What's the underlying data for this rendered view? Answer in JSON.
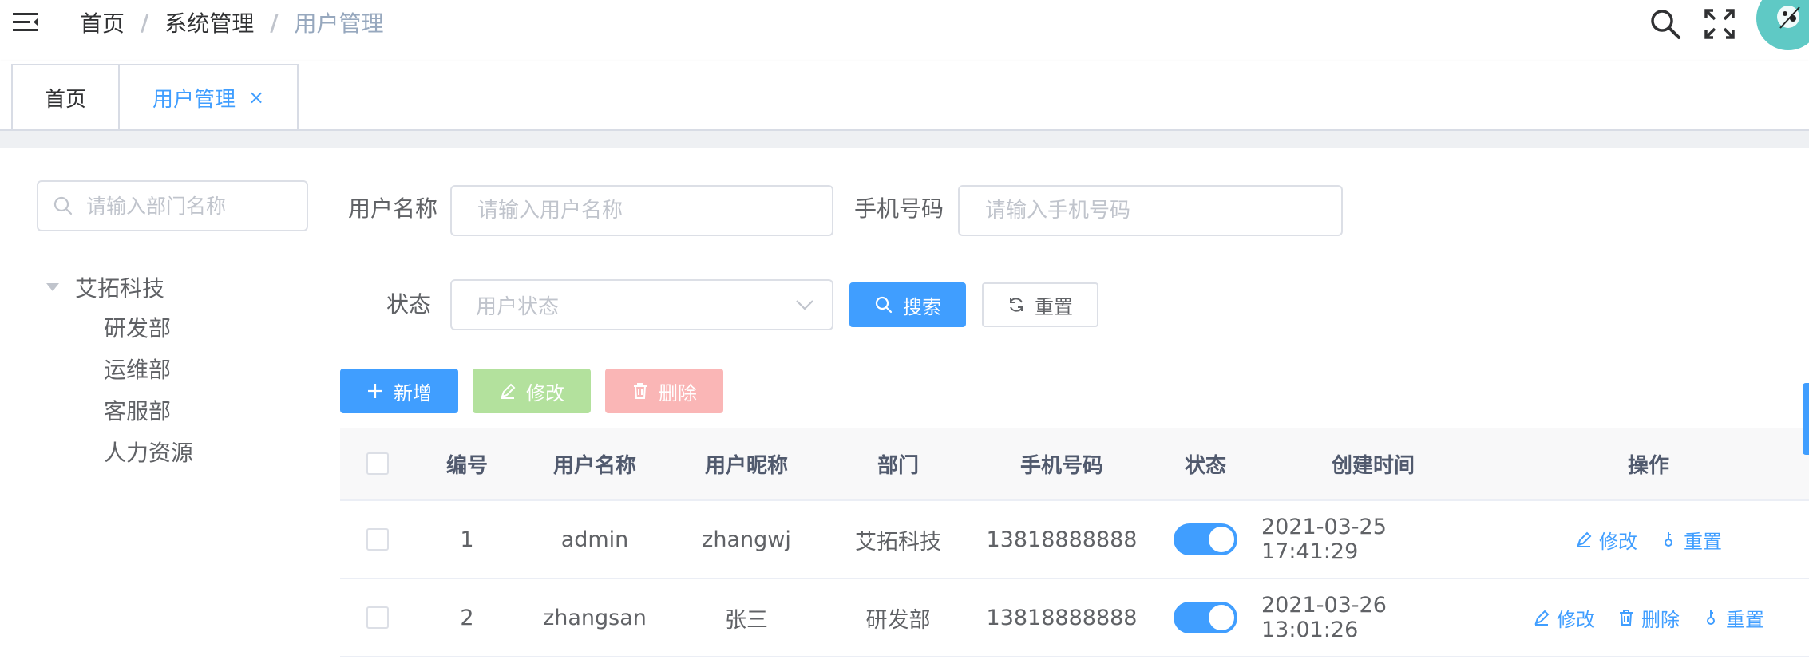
{
  "breadcrumb": [
    "首页",
    "系统管理",
    "用户管理"
  ],
  "breadcrumb_separator": "/",
  "tags": {
    "home": "首页",
    "active": "用户管理",
    "close": "×"
  },
  "dept": {
    "search_placeholder": "请输入部门名称",
    "root": "艾拓科技",
    "children": [
      "研发部",
      "运维部",
      "客服部",
      "人力资源"
    ]
  },
  "form": {
    "username_label": "用户名称",
    "username_placeholder": "请输入用户名称",
    "phone_label": "手机号码",
    "phone_placeholder": "请输入手机号码",
    "status_label": "状态",
    "status_placeholder": "用户状态",
    "search_button": "搜索",
    "reset_button": "重置"
  },
  "toolbar": {
    "add": "新增",
    "edit": "修改",
    "delete": "删除"
  },
  "table": {
    "headers": [
      "编号",
      "用户名称",
      "用户昵称",
      "部门",
      "手机号码",
      "状态",
      "创建时间",
      "操作"
    ],
    "rows": [
      {
        "id": "1",
        "username": "admin",
        "nickname": "zhangwj",
        "dept": "艾拓科技",
        "phone": "13818888888",
        "status": true,
        "created": "2021-03-25 17:41:29",
        "ops": [
          "修改",
          "重置"
        ]
      },
      {
        "id": "2",
        "username": "zhangsan",
        "nickname": "张三",
        "dept": "研发部",
        "phone": "13818888888",
        "status": true,
        "created": "2021-03-26 13:01:26",
        "ops": [
          "修改",
          "删除",
          "重置"
        ]
      }
    ]
  },
  "colors": {
    "primary": "#409eff",
    "success_disabled": "#b3e19d",
    "danger_disabled": "#fab6b6",
    "avatar": "#5fc9c5"
  }
}
